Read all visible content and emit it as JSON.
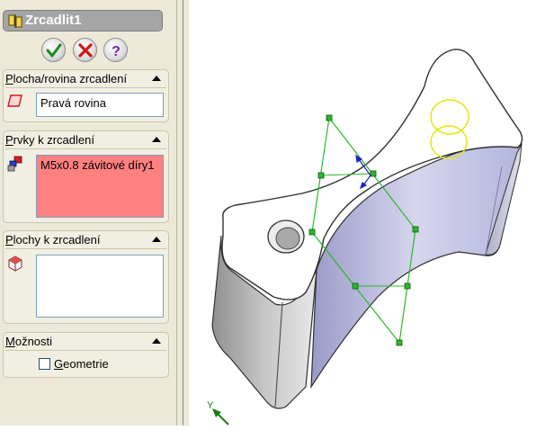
{
  "property_manager": {
    "title": "Zrcadlit1",
    "buttons": {
      "ok": "ok-icon",
      "cancel": "cancel-icon",
      "help": "help-icon"
    },
    "groups": {
      "mirror_plane": {
        "title_mnemonic": "P",
        "title_rest": "locha/rovina zrcadlení",
        "value": "Pravá rovina"
      },
      "features": {
        "title_mnemonic": "P",
        "title_rest": "rvky k zrcadlení",
        "value": "M5x0.8 závitové díry1"
      },
      "faces": {
        "title_mnemonic": "P",
        "title_rest": "lochy k zrcadlení",
        "value": ""
      },
      "options": {
        "title_mnemonic": "M",
        "title_rest": "ožnosti",
        "checkbox_mnemonic": "G",
        "checkbox_rest": "eometrie",
        "checkbox_checked": false
      }
    }
  },
  "viewport": {
    "axis_label": "Y",
    "colors": {
      "plane_outline": "#2bb82b",
      "hole_highlight": "#e4e400",
      "part_face": "#c8c8e8"
    }
  }
}
